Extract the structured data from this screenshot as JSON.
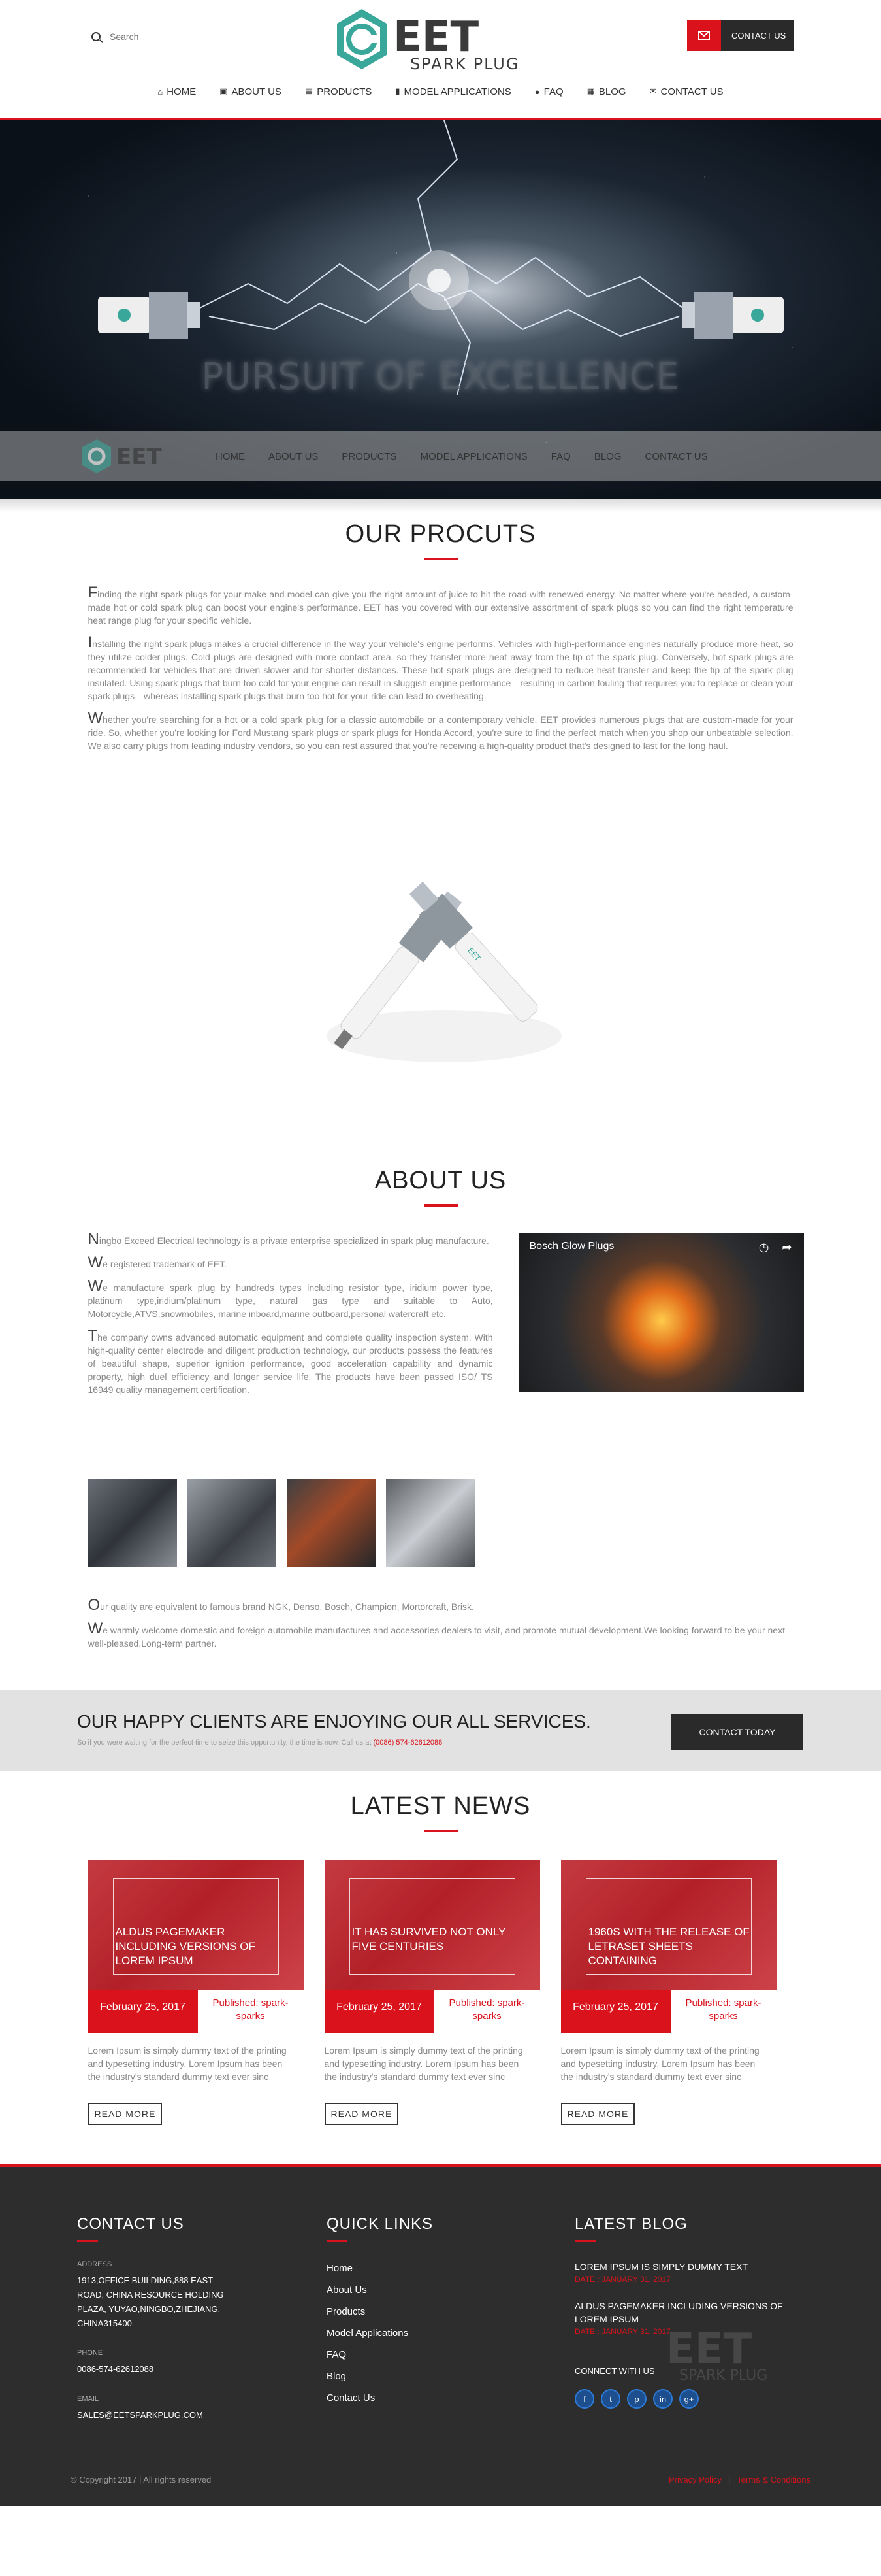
{
  "header": {
    "search_placeholder": "Search",
    "logo_letters": "EET",
    "logo_sub": "SPARK PLUG",
    "contact_button": "CONTACT US"
  },
  "nav": [
    {
      "label": "HOME",
      "icon": "home-icon"
    },
    {
      "label": "ABOUT US",
      "icon": "info-icon"
    },
    {
      "label": "PRODUCTS",
      "icon": "cart-icon"
    },
    {
      "label": "MODEL APPLICATIONS",
      "icon": "book-icon"
    },
    {
      "label": "FAQ",
      "icon": "question-icon"
    },
    {
      "label": "BLOG",
      "icon": "blog-icon"
    },
    {
      "label": "CONTACT US",
      "icon": "envelope-icon"
    }
  ],
  "hero": {
    "title": "PURSUIT OF EXCELLENCE",
    "strip_nav": [
      "HOME",
      "ABOUT US",
      "PRODUCTS",
      "MODEL APPLICATIONS",
      "FAQ",
      "BLOG",
      "CONTACT US"
    ]
  },
  "products": {
    "title": "OUR PROCUTS",
    "paragraphs": [
      "Finding the right spark plugs for your make and model can give you the right amount of juice to hit the road with renewed energy. No matter where you're headed, a custom-made hot or cold spark plug can boost your engine's performance. EET has you covered with our extensive assortment of spark plugs so you can find the right temperature heat range plug for your specific vehicle.",
      "Installing the right spark plugs makes a crucial difference in the way your vehicle's engine performs. Vehicles with high-performance engines naturally produce more heat, so they utilize colder plugs. Cold plugs are designed with more contact area, so they transfer more heat away from the tip of the spark plug. Conversely, hot spark plugs are recommended for vehicles that are driven slower and for shorter distances. These hot spark plugs are designed to reduce heat transfer and keep the tip of the spark plug insulated. Using spark plugs that burn too cold for your engine can result in sluggish engine performance—resulting in carbon fouling that requires you to replace or clean your spark plugs—whereas installing spark plugs that burn too hot for your ride can lead to overheating.",
      "Whether you're searching for a hot or a cold spark plug for a classic automobile or a contemporary vehicle, EET provides numerous plugs that are custom-made for your ride. So, whether you're looking for Ford Mustang spark plugs or spark plugs for Honda Accord, you're sure to find the perfect match when you shop our unbeatable selection. We also carry plugs from leading industry vendors, so you can rest assured that you're receiving a high-quality product that's designed to last for the long haul."
    ]
  },
  "about": {
    "title": "ABOUT US",
    "paragraphs": [
      "Ningbo Exceed Electrical technology is a private enterprise specialized in spark plug manufacture.",
      "We registered trademark of EET.",
      "We manufacture spark plug by hundreds types including resistor type, iridium power type, platinum type,iridium/platinum type, natural gas type and suitable to Auto, Motorcycle,ATVS,snowmobiles, marine inboard,marine outboard,personal watercraft etc.",
      "The company owns advanced automatic equipment and complete quality inspection system. With high-quality center electrode and diligent production technology, our products possess the features of beautiful shape, superior ignition performance, good acceleration capability and dynamic property, high duel efficiency and longer service life. The products have been passed ISO/ TS 16949 quality management certification."
    ],
    "video_title": "Bosch Glow Plugs",
    "bottom_paragraphs": [
      "Our quality are equivalent to famous brand NGK, Denso, Bosch, Champion, Mortorcraft, Brisk.",
      "We warmly welcome domestic and foreign automobile manufactures and accessories dealers to visit, and promote mutual development.We looking forward to be your next well-pleased,Long-term partner."
    ]
  },
  "cta": {
    "title": "OUR HAPPY CLIENTS ARE ENJOYING OUR ALL SERVICES.",
    "sub": "So if you were waiting for the perfect time to seize this opportunity, the time is now. Call us at",
    "phone": "(0086) 574-62612088",
    "button": "CONTACT TODAY"
  },
  "news": {
    "title": "LATEST NEWS",
    "cards": [
      {
        "caption": "ALDUS PAGEMAKER INCLUDING VERSIONS OF LOREM IPSUM",
        "date": "February 25, 2017",
        "published": "Published: spark-sparks",
        "desc": "Lorem Ipsum is simply dummy text of the printing and typesetting industry. Lorem Ipsum has been the industry's standard dummy text ever sinc",
        "button": "READ MORE"
      },
      {
        "caption": "IT HAS SURVIVED NOT ONLY FIVE CENTURIES",
        "date": "February 25, 2017",
        "published": "Published: spark-sparks",
        "desc": "Lorem Ipsum is simply dummy text of the printing and typesetting industry. Lorem Ipsum has been the industry's standard dummy text ever sinc",
        "button": "READ MORE"
      },
      {
        "caption": "1960S WITH THE RELEASE OF LETRASET SHEETS CONTAINING",
        "date": "February 25, 2017",
        "published": "Published: spark-sparks",
        "desc": "Lorem Ipsum is simply dummy text of the printing and typesetting industry. Lorem Ipsum has been the industry's standard dummy text ever sinc",
        "button": "READ MORE"
      }
    ]
  },
  "footer": {
    "contact_title": "CONTACT US",
    "address_label": "ADDRESS",
    "address": "1913,OFFICE BUILDING,888 EAST ROAD, CHINA RESOURCE HOLDING PLAZA, YUYAO,NINGBO,ZHEJIANG, CHINA315400",
    "phone_label": "PHONE",
    "phone": "0086-574-62612088",
    "email_label": "EMAIL",
    "email": "SALES@EETSPARKPLUG.COM",
    "quick_title": "QUICK LINKS",
    "quick_links": [
      "Home",
      "About Us",
      "Products",
      "Model Applications",
      "FAQ",
      "Blog",
      "Contact Us"
    ],
    "blog_title": "LATEST BLOG",
    "posts": [
      {
        "title": "LOREM IPSUM IS SIMPLY DUMMY TEXT",
        "date": "DATE : JANUARY 31, 2017"
      },
      {
        "title": "ALDUS PAGEMAKER INCLUDING VERSIONS OF LOREM IPSUM",
        "date": "DATE : JANUARY 31, 2017"
      }
    ],
    "connect": "CONNECT WITH US",
    "socials": [
      "f",
      "t",
      "p",
      "in",
      "g+"
    ],
    "copyright": "© Copyright 2017  |  All rights reserved",
    "privacy": "Privacy Policy",
    "terms": "Terms & Conditions"
  },
  "colors": {
    "accent": "#d9121c",
    "dark": "#2a2a2a",
    "teal": "#3aa79b"
  }
}
